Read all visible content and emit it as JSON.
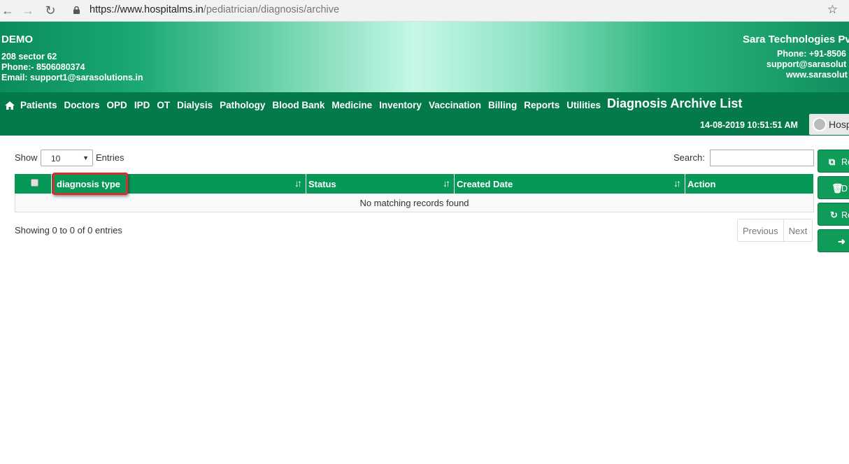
{
  "browser": {
    "url_host": "https://www.hospitalms.in",
    "url_path": "/pediatrician/diagnosis/archive"
  },
  "header": {
    "hospital_name": "DEMO",
    "address": "208 sector 62",
    "phone": "Phone:- 8506080374",
    "email": "Email: support1@sarasolutions.in",
    "company_name": "Sara Technologies Pv",
    "company_phone": "Phone: +91-8506",
    "company_email": "support@sarasolut",
    "company_web": "www.sarasolut"
  },
  "menu": {
    "items": [
      "Patients",
      "Doctors",
      "OPD",
      "IPD",
      "OT",
      "Dialysis",
      "Pathology",
      "Blood Bank",
      "Medicine",
      "Inventory",
      "Vaccination",
      "Billing",
      "Reports",
      "Utilities"
    ],
    "page_title": "Diagnosis Archive List",
    "datetime": "14-08-2019 10:51:51 AM",
    "user_label": "Hosp"
  },
  "controls": {
    "show_label": "Show",
    "page_length": "10",
    "entries_label": "Entries",
    "search_label": "Search:",
    "search_value": ""
  },
  "table": {
    "columns": [
      "diagnosis type",
      "Status",
      "Created Date",
      "Action"
    ],
    "empty_message": "No matching records found"
  },
  "footer": {
    "info": "Showing 0 to 0 of 0 entries",
    "previous": "Previous",
    "next": "Next"
  },
  "side_buttons": [
    {
      "icon": "restore-icon",
      "label": "Re"
    },
    {
      "icon": "trash-icon",
      "label": "D"
    },
    {
      "icon": "refresh-icon",
      "label": "Re"
    },
    {
      "icon": "sign-out-icon",
      "label": ""
    }
  ],
  "colors": {
    "primary_green": "#047a4b",
    "table_header_green": "#069857",
    "highlight_red": "#d32f2f"
  }
}
